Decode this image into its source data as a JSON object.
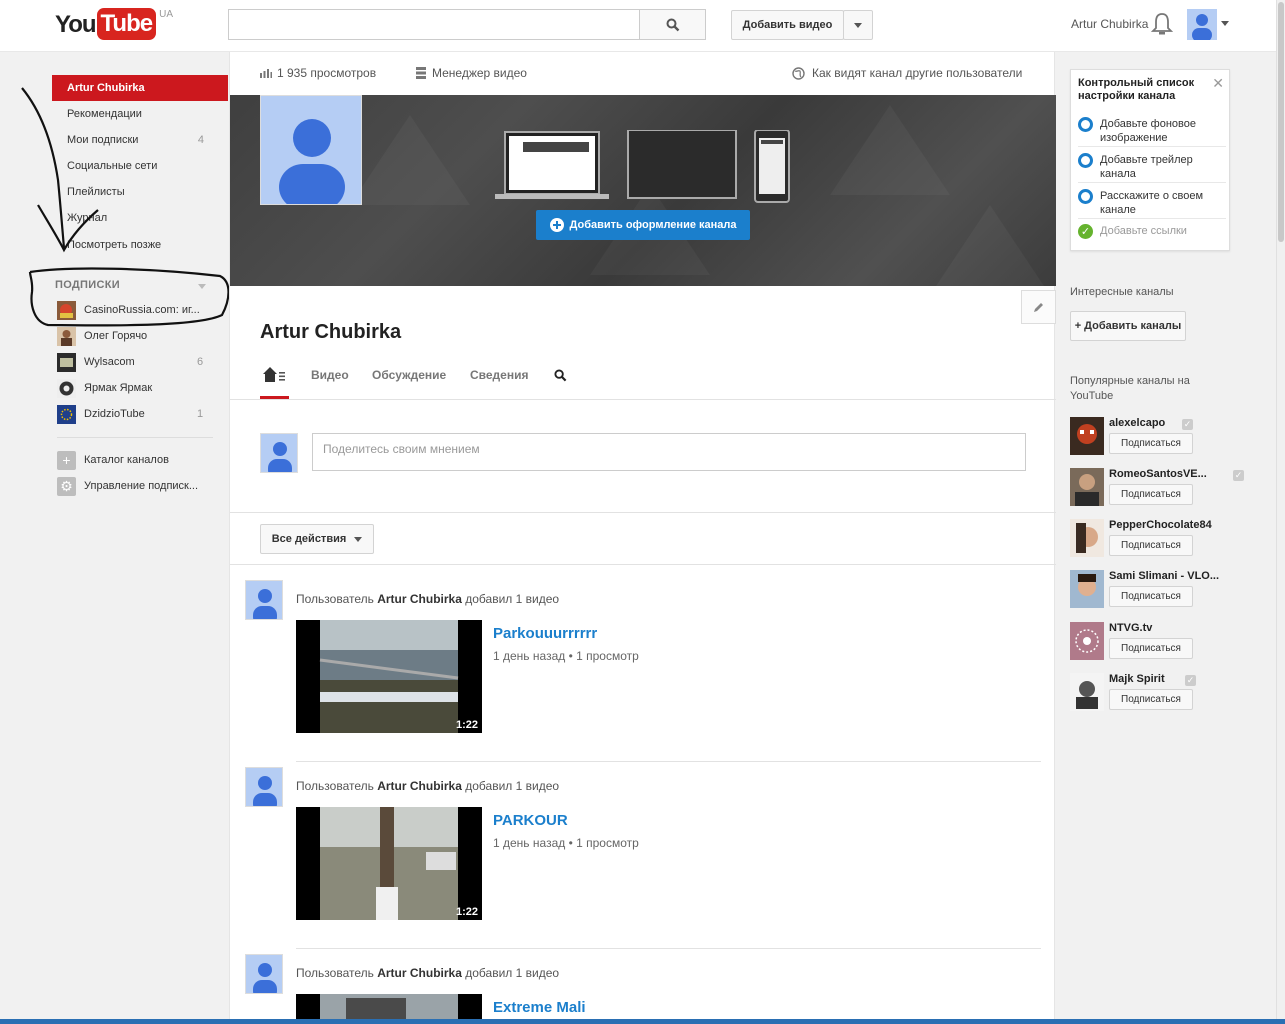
{
  "header": {
    "logo_you": "You",
    "logo_tube": "Tube",
    "logo_country": "UA",
    "search_placeholder": "",
    "upload_label": "Добавить видео",
    "user_name": "Artur Chubirka"
  },
  "guide": {
    "items": [
      {
        "label": "Artur Chubirka",
        "active": true
      },
      {
        "label": "Рекомендации"
      },
      {
        "label": "Мои подписки",
        "count": "4"
      },
      {
        "label": "Социальные сети"
      },
      {
        "label": "Плейлисты"
      },
      {
        "label": "Журнал"
      },
      {
        "label": "Посмотреть позже"
      }
    ],
    "subs_heading": "ПОДПИСКИ",
    "subscriptions": [
      {
        "label": "CasinoRussia.com: иг...",
        "count": ""
      },
      {
        "label": "Олег Горячо",
        "count": ""
      },
      {
        "label": "Wylsacom",
        "count": "6"
      },
      {
        "label": "Ярмак Ярмак",
        "count": ""
      },
      {
        "label": "DzidzioTube",
        "count": "1"
      }
    ],
    "catalog_label": "Каталог каналов",
    "manage_label": "Управление подписк..."
  },
  "topbar": {
    "views": "1 935 просмотров",
    "video_manager": "Менеджер видео",
    "view_as": "Как видят канал другие пользователи"
  },
  "channel": {
    "add_art_label": "Добавить оформление канала",
    "title": "Artur Chubirka",
    "tabs": [
      "Видео",
      "Обсуждение",
      "Сведения"
    ],
    "post_placeholder": "Поделитесь своим мнением",
    "actions_label": "Все действия"
  },
  "feed": [
    {
      "prefix": "Пользователь ",
      "user": "Artur Chubirka",
      "suffix": " добавил 1 видео",
      "title": "Parkouuurrrrrr",
      "meta": "1 день назад • 1 просмотр",
      "duration": "1:22"
    },
    {
      "prefix": "Пользователь ",
      "user": "Artur Chubirka",
      "suffix": " добавил 1 видео",
      "title": "PARKOUR",
      "meta": "1 день назад • 1 просмотр",
      "duration": "1:22"
    },
    {
      "prefix": "Пользователь ",
      "user": "Artur Chubirka",
      "suffix": " добавил 1 видео",
      "title": "Extreme Mali",
      "meta": "",
      "duration": ""
    }
  ],
  "checklist": {
    "title": "Контрольный список настройки канала",
    "items": [
      {
        "label": "Добавьте фоновое изображение",
        "done": false
      },
      {
        "label": "Добавьте трейлер канала",
        "done": false
      },
      {
        "label": "Расскажите о своем канале",
        "done": false
      },
      {
        "label": "Добавьте ссылки",
        "done": true
      }
    ]
  },
  "right": {
    "interesting_label": "Интересные каналы",
    "add_channels_label": "+ Добавить каналы",
    "popular_label": "Популярные каналы на YouTube",
    "subscribe_label": "Подписаться",
    "popular": [
      {
        "name": "alexelcapo",
        "verified": true
      },
      {
        "name": "RomeoSantosVE...",
        "verified": true
      },
      {
        "name": "PepperChocolate84",
        "verified": false
      },
      {
        "name": "Sami Slimani - VLO...",
        "verified": false
      },
      {
        "name": "NTVG.tv",
        "verified": false
      },
      {
        "name": "Majk Spirit",
        "verified": true
      }
    ]
  },
  "colors": {
    "accent_red": "#cc181e",
    "link_blue": "#1b7fcc",
    "avatar_blue": "#b5cdf4"
  }
}
